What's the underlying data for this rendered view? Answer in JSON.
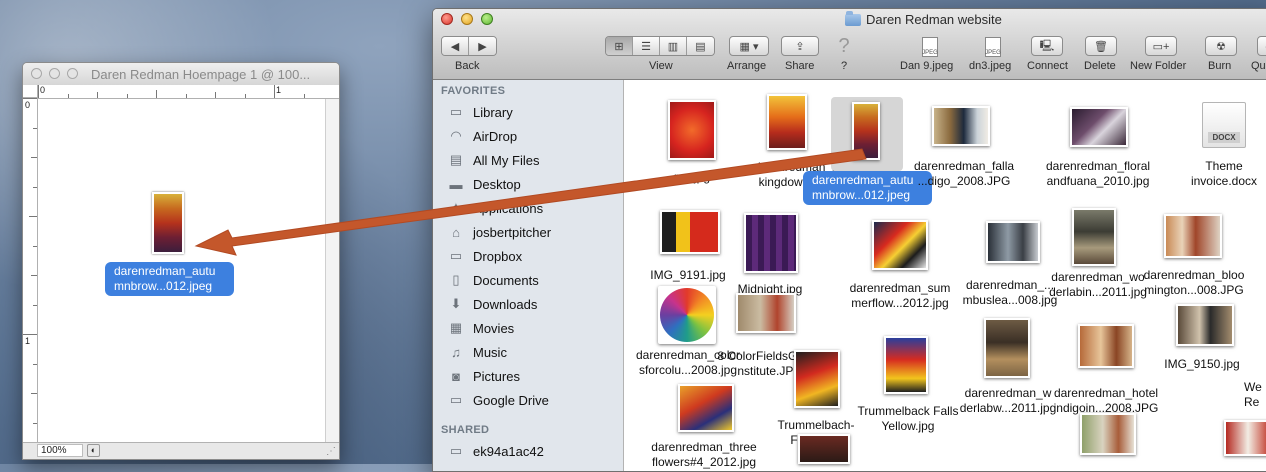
{
  "doc_window": {
    "title": "Daren Redman Hoempage 1 @ 100...",
    "ruler_top_labels": [
      "0",
      "1"
    ],
    "ruler_left_labels": [
      "0",
      "1"
    ],
    "zoom": "100%",
    "dragged_file_label": "darenredman_autu\nmnbrow...012.jpeg"
  },
  "finder": {
    "title": "Daren Redman website",
    "toolbar": {
      "back_label": "Back",
      "view_label": "View",
      "arrange_label": "Arrange",
      "share_label": "Share",
      "help_label": "?",
      "file1_label": "Dan 9.jpeg",
      "file2_label": "dn3.jpeg",
      "connect_label": "Connect",
      "delete_label": "Delete",
      "new_folder_label": "New Folder",
      "burn_label": "Burn",
      "quick_label": "Qu"
    },
    "sidebar": {
      "favorites_header": "FAVORITES",
      "items": [
        "Library",
        "AirDrop",
        "All My Files",
        "Desktop",
        "Applications",
        "josbertpitcher",
        "Dropbox",
        "Documents",
        "Downloads",
        "Movies",
        "Music",
        "Pictures",
        "Google Drive"
      ],
      "shared_header": "SHARED",
      "shared_items": [
        "ek94a1ac42"
      ]
    },
    "files": {
      "f1": "...me.jpg",
      "f2": "darenredman_brea\nkingdown_20...",
      "selected": "darenredman_autu\nmnbrow...012.jpeg",
      "f4": "darenredman_falla\n...digo_2008.JPG",
      "f5": "darenredman_floral\nandfuana_2010.jpg",
      "f6": "Theme\ninvoice.docx",
      "f6_badge": "DOCX",
      "f7": "IMG_9191.jpg",
      "f8": "Midnight.jpg",
      "f9": "darenredman_sum\nmerflow...2012.jpg",
      "f10": "darenredman_...\nmbuslea...008.jpg",
      "f11": "darenredman_wo\nderlabin...2011.jpg",
      "f12": "darenredman_bloo\nmington...008.JPG",
      "f13": "darenredman_color\nsforcolu...2008.jpg",
      "f14": "8 ColorFieldsGlickE\nnstitute.JPG",
      "f15": "Trummelback Falls\nYellow.jpg",
      "f16": "darenredman_w\nderlabw...2011.jpg",
      "f17": "darenredman_hotel\nindigoin...2008.JPG",
      "f18": "IMG_9150.jpg",
      "f19": "Trummelbach-\nFalls...jpg",
      "f20": "darenredman_three\nflowers#4_2012.jpg",
      "f21": "We\nRe"
    }
  }
}
